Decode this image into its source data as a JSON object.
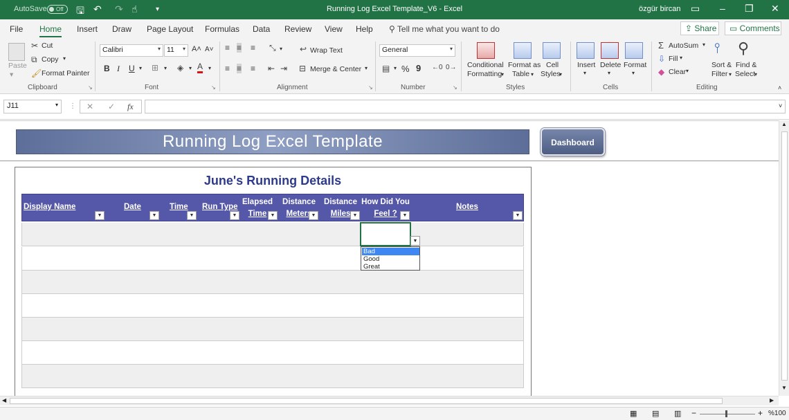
{
  "titlebar": {
    "autosave_label": "AutoSave",
    "autosave_state": "Off",
    "window_title": "Running Log Excel Template_V6  -  Excel",
    "user": "özgür bircan"
  },
  "tabs": [
    "File",
    "Home",
    "Insert",
    "Draw",
    "Page Layout",
    "Formulas",
    "Data",
    "Review",
    "View",
    "Help"
  ],
  "tell_me": "Tell me what you want to do",
  "share_label": "Share",
  "comments_label": "Comments",
  "ribbon": {
    "clipboard": {
      "paste": "Paste",
      "cut": "Cut",
      "copy": "Copy",
      "format_painter": "Format Painter",
      "label": "Clipboard"
    },
    "font": {
      "name": "Calibri",
      "size": "11",
      "label": "Font",
      "bold": "B",
      "italic": "I",
      "underline": "U"
    },
    "alignment": {
      "wrap_text": "Wrap Text",
      "merge_center": "Merge & Center",
      "label": "Alignment"
    },
    "number": {
      "format": "General",
      "label": "Number",
      "percent": "%",
      "comma": "9"
    },
    "styles": {
      "conditional": "Conditional",
      "formatting": "Formatting",
      "format_as": "Format as",
      "table": "Table",
      "cell": "Cell",
      "styles_word": "Styles",
      "label": "Styles"
    },
    "cells": {
      "insert": "Insert",
      "delete": "Delete",
      "format": "Format",
      "label": "Cells"
    },
    "editing": {
      "autosum": "AutoSum",
      "fill": "Fill",
      "clear": "Clear",
      "sort_filter_1": "Sort &",
      "sort_filter_2": "Filter",
      "find_select_1": "Find &",
      "find_select_2": "Select",
      "label": "Editing"
    }
  },
  "formula_bar": {
    "name_box": "J11",
    "fx": "fx",
    "cancel": "✕",
    "enter": "✓",
    "content": ""
  },
  "sheet": {
    "banner_title": "Running Log Excel Template",
    "dashboard_button": "Dashboard",
    "section_title": "June's Running Details",
    "headers": {
      "display_name": "Display Name",
      "date": "Date",
      "time": "Time",
      "run_type": "Run Type",
      "elapsed_1": "Elapsed",
      "elapsed_2": "Time",
      "dist_m_1": "Distance",
      "dist_m_2": "Meters",
      "dist_mi_1": "Distance",
      "dist_mi_2": "Miles",
      "feel_1": "How Did You",
      "feel_2": "Feel ?",
      "notes": "Notes"
    },
    "feel_options": [
      "Bad",
      "Good",
      "Great"
    ],
    "feel_selected": "Bad"
  },
  "status": {
    "zoom": "%100"
  },
  "colors": {
    "excel_green": "#217346",
    "header_blue": "#5557a8",
    "title_navy": "#2e3a8c",
    "selection_blue": "#3e86f1"
  }
}
